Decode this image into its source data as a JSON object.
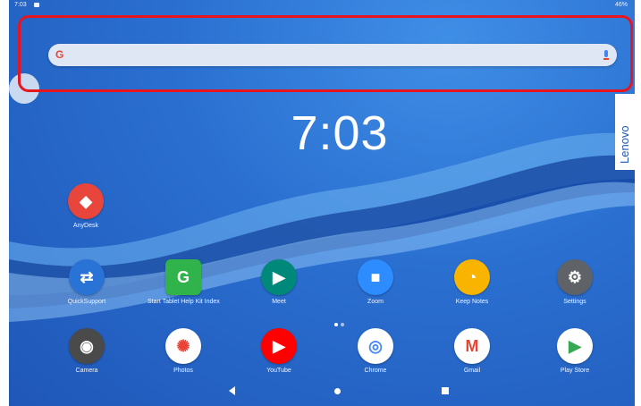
{
  "status_bar": {
    "time": "7:03",
    "battery": "46%"
  },
  "search": {
    "logo": "G",
    "mic_icon": "mic-icon"
  },
  "brand": "Lenovo",
  "clock": "7:03",
  "apps_top": [
    {
      "label": "AnyDesk",
      "color": "#e8453c",
      "icon": "anydesk-icon"
    }
  ],
  "apps_row1": [
    {
      "label": "QuickSupport",
      "color": "#2a73d6",
      "icon": "quicksupport-icon"
    },
    {
      "label": "Start Tablet Help Kit Index",
      "color": "#2fb34a",
      "icon": "helpkit-icon"
    },
    {
      "label": "Meet",
      "color": "#00897b",
      "icon": "meet-icon"
    },
    {
      "label": "Zoom",
      "color": "#2d8cff",
      "icon": "zoom-icon"
    },
    {
      "label": "Keep Notes",
      "color": "#f9b400",
      "icon": "keep-icon"
    },
    {
      "label": "Settings",
      "color": "#5f6368",
      "icon": "gear-icon"
    }
  ],
  "apps_row2": [
    {
      "label": "Camera",
      "color": "#4a4a4a",
      "icon": "camera-icon"
    },
    {
      "label": "Photos",
      "color": "#ffffff",
      "icon": "photos-icon"
    },
    {
      "label": "YouTube",
      "color": "#ff0000",
      "icon": "youtube-icon"
    },
    {
      "label": "Chrome",
      "color": "#ffffff",
      "icon": "chrome-icon"
    },
    {
      "label": "Gmail",
      "color": "#ffffff",
      "icon": "gmail-icon"
    },
    {
      "label": "Play Store",
      "color": "#ffffff",
      "icon": "play-store-icon"
    }
  ],
  "colors": {
    "highlight": "#e8141e",
    "background": "#2a6fd0"
  }
}
